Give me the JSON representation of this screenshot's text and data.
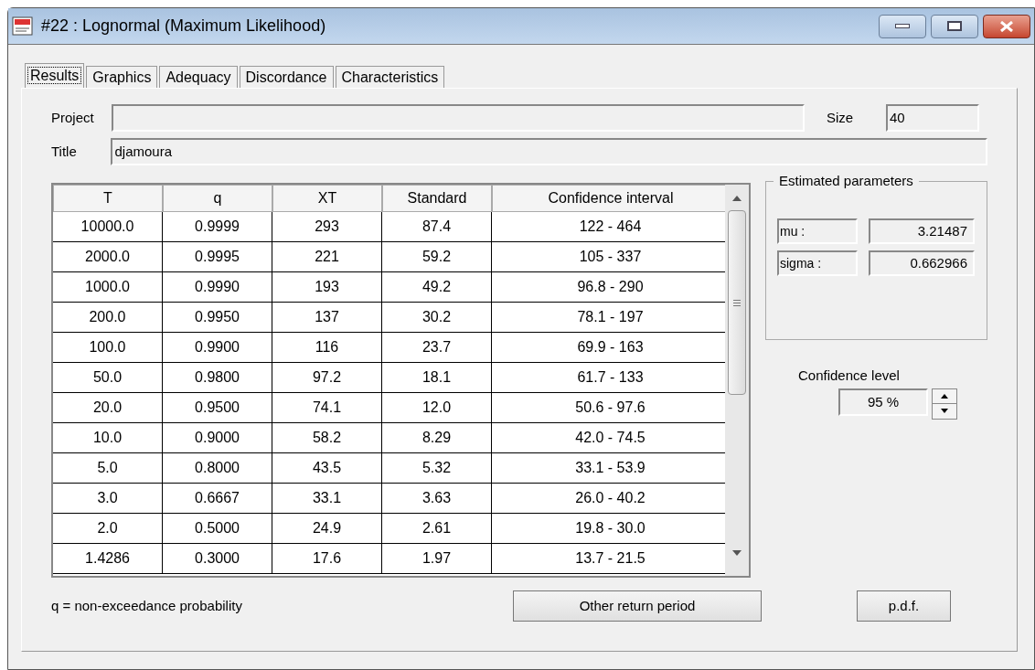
{
  "window": {
    "title": "#22 : Lognormal (Maximum Likelihood)"
  },
  "tabs": [
    {
      "label": "Results",
      "selected": true
    },
    {
      "label": "Graphics",
      "selected": false
    },
    {
      "label": "Adequacy",
      "selected": false
    },
    {
      "label": "Discordance",
      "selected": false
    },
    {
      "label": "Characteristics",
      "selected": false
    }
  ],
  "project": {
    "label": "Project"
  },
  "size": {
    "label": "Size",
    "value": "40"
  },
  "title_field": {
    "label": "Title",
    "value": "djamoura"
  },
  "table": {
    "columns": [
      "T",
      "q",
      "XT",
      "Standard",
      "Confidence interval"
    ],
    "rows": [
      [
        "10000.0",
        "0.9999",
        "293",
        "87.4",
        "122 - 464"
      ],
      [
        "2000.0",
        "0.9995",
        "221",
        "59.2",
        "105 - 337"
      ],
      [
        "1000.0",
        "0.9990",
        "193",
        "49.2",
        "96.8 - 290"
      ],
      [
        "200.0",
        "0.9950",
        "137",
        "30.2",
        "78.1 - 197"
      ],
      [
        "100.0",
        "0.9900",
        "116",
        "23.7",
        "69.9 - 163"
      ],
      [
        "50.0",
        "0.9800",
        "97.2",
        "18.1",
        "61.7 - 133"
      ],
      [
        "20.0",
        "0.9500",
        "74.1",
        "12.0",
        "50.6 - 97.6"
      ],
      [
        "10.0",
        "0.9000",
        "58.2",
        "8.29",
        "42.0 - 74.5"
      ],
      [
        "5.0",
        "0.8000",
        "43.5",
        "5.32",
        "33.1 - 53.9"
      ],
      [
        "3.0",
        "0.6667",
        "33.1",
        "3.63",
        "26.0 - 40.2"
      ],
      [
        "2.0",
        "0.5000",
        "24.9",
        "2.61",
        "19.8 - 30.0"
      ],
      [
        "1.4286",
        "0.3000",
        "17.6",
        "1.97",
        "13.7 - 21.5"
      ]
    ]
  },
  "estimated_parameters": {
    "title": "Estimated parameters",
    "params": [
      {
        "name": "mu :",
        "value": "3.21487"
      },
      {
        "name": "sigma :",
        "value": "0.662966"
      }
    ]
  },
  "confidence_level": {
    "label": "Confidence level",
    "value": "95 %"
  },
  "note": "q = non-exceedance probability",
  "buttons": [
    "Other return period",
    "p.d.f."
  ]
}
